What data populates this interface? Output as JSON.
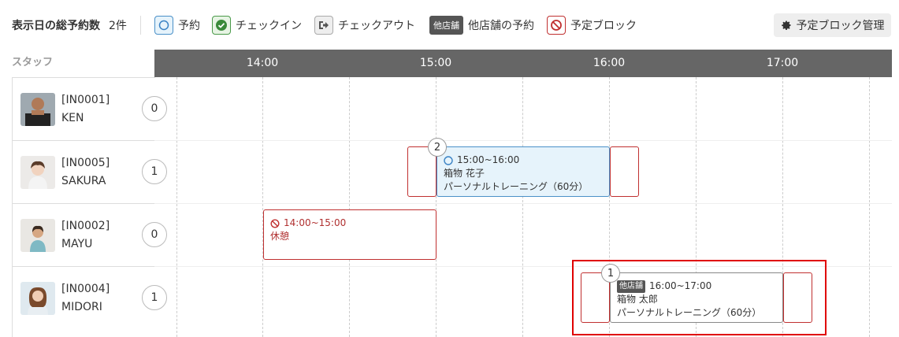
{
  "legend": {
    "total_label": "表示日の総予約数",
    "total_count": "2件",
    "reservation": "予約",
    "checkin": "チェックイン",
    "checkout": "チェックアウト",
    "other_store_tag": "他店舗",
    "other_store": "他店舗の予約",
    "block": "予定ブロック",
    "manage_button": "予定ブロック管理"
  },
  "staff_header": "スタッフ",
  "hours": [
    "14:00",
    "15:00",
    "16:00",
    "17:00"
  ],
  "staff": [
    {
      "code": "[IN0001]",
      "name": "KEN",
      "count": "0"
    },
    {
      "code": "[IN0005]",
      "name": "SAKURA",
      "count": "1"
    },
    {
      "code": "[IN0002]",
      "name": "MAYU",
      "count": "0"
    },
    {
      "code": "[IN0004]",
      "name": "MIDORI",
      "count": "1"
    }
  ],
  "events": {
    "sakura": {
      "badge": "2",
      "time": "15:00~16:00",
      "customer": "箱物 花子",
      "menu": "パーソナルトレーニング（60分）"
    },
    "mayu": {
      "time": "14:00~15:00",
      "title": "休憩"
    },
    "midori": {
      "badge": "1",
      "tag": "他店舗",
      "time": "16:00~17:00",
      "customer": "箱物 太郎",
      "menu": "パーソナルトレーニング（60分）"
    }
  },
  "colors": {
    "header_bg": "#666666",
    "reservation": "#4a90c8",
    "block": "#c03030",
    "highlight": "#e00000"
  }
}
